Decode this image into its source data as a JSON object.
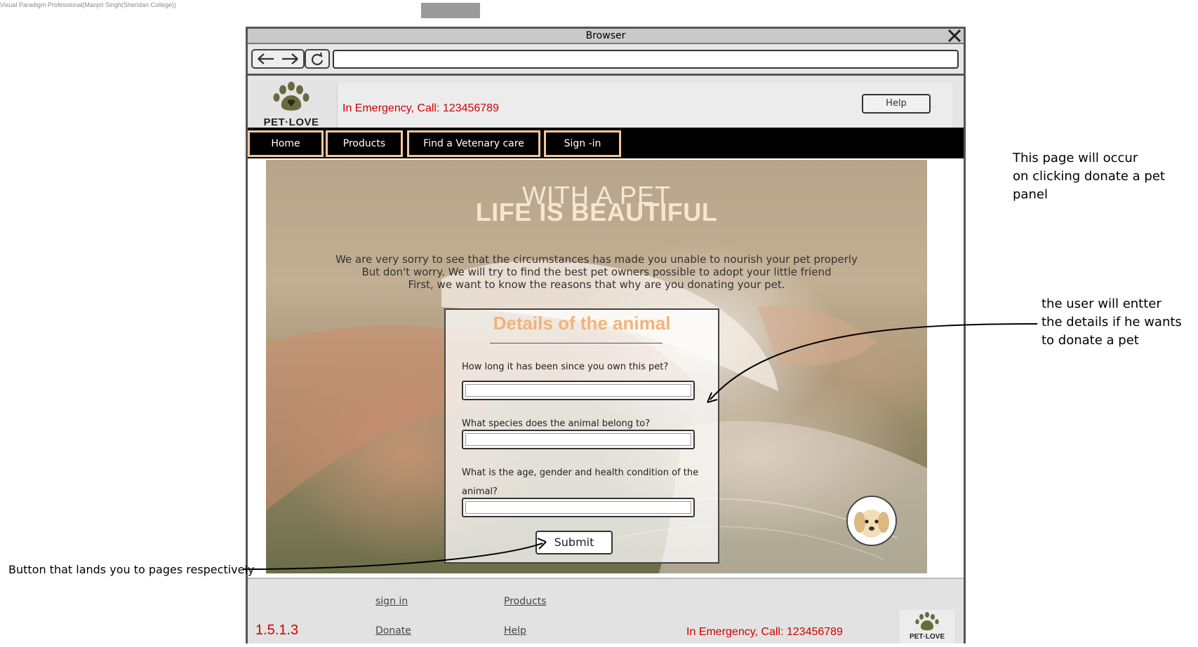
{
  "watermark": "Visual Paradigm Professional(Manjot Singh(Sheridan College))",
  "browser": {
    "title": "Browser",
    "close_glyph": "✕",
    "url_value": ""
  },
  "header": {
    "logo_text": "PET·LOVE",
    "emergency": "In Emergency, Call: 123456789",
    "help_label": "Help"
  },
  "nav": {
    "items": [
      {
        "label": "Home"
      },
      {
        "label": "Products"
      },
      {
        "label": "Find a Vetenary care"
      },
      {
        "label": "Sign -in"
      }
    ]
  },
  "hero": {
    "title_line1": "WITH A PET",
    "title_line2": "LIFE IS BEAUTIFUL",
    "paragraph": [
      "We are  very sorry to see that the circumstances has made you unable to nourish your pet properly",
      "But don't worry. We will try to find the best pet owners possible to adopt your little friend",
      "First, we want to know the reasons that why are you donating your pet."
    ]
  },
  "form": {
    "title": "Details of the animal",
    "questions": [
      {
        "label": "How long it has been since you own this pet?",
        "value": ""
      },
      {
        "label": "What species does the animal belong to?",
        "value": ""
      },
      {
        "label_line1": "What is the age, gender and health condition of the",
        "label_line2": "animal?",
        "value": ""
      }
    ],
    "submit_label": "Submit"
  },
  "footer": {
    "links": [
      {
        "label": "sign in"
      },
      {
        "label": "Products"
      },
      {
        "label": "Donate"
      },
      {
        "label": "Help"
      }
    ],
    "version": "1.5.1.3",
    "emergency": "In Emergency, Call: 123456789",
    "logo_text": "PET·LOVE"
  },
  "annotations": {
    "page_note_line1": "This page will occur",
    "page_note_line2": "on clicking donate a pet panel",
    "form_note_line1": "the user will entter",
    "form_note_line2": "the details if he wants",
    "form_note_line3": "to donate a pet",
    "button_note": "Button that lands  you to pages respectively"
  },
  "colors": {
    "emergency_red": "#d00000",
    "nav_border": "#f3c89c",
    "form_title": "#f3b27a",
    "paw_green": "#6b6a3e"
  },
  "icons": [
    "paw-icon",
    "back-arrow-icon",
    "forward-arrow-icon",
    "refresh-icon",
    "close-icon",
    "puppy-avatar"
  ]
}
